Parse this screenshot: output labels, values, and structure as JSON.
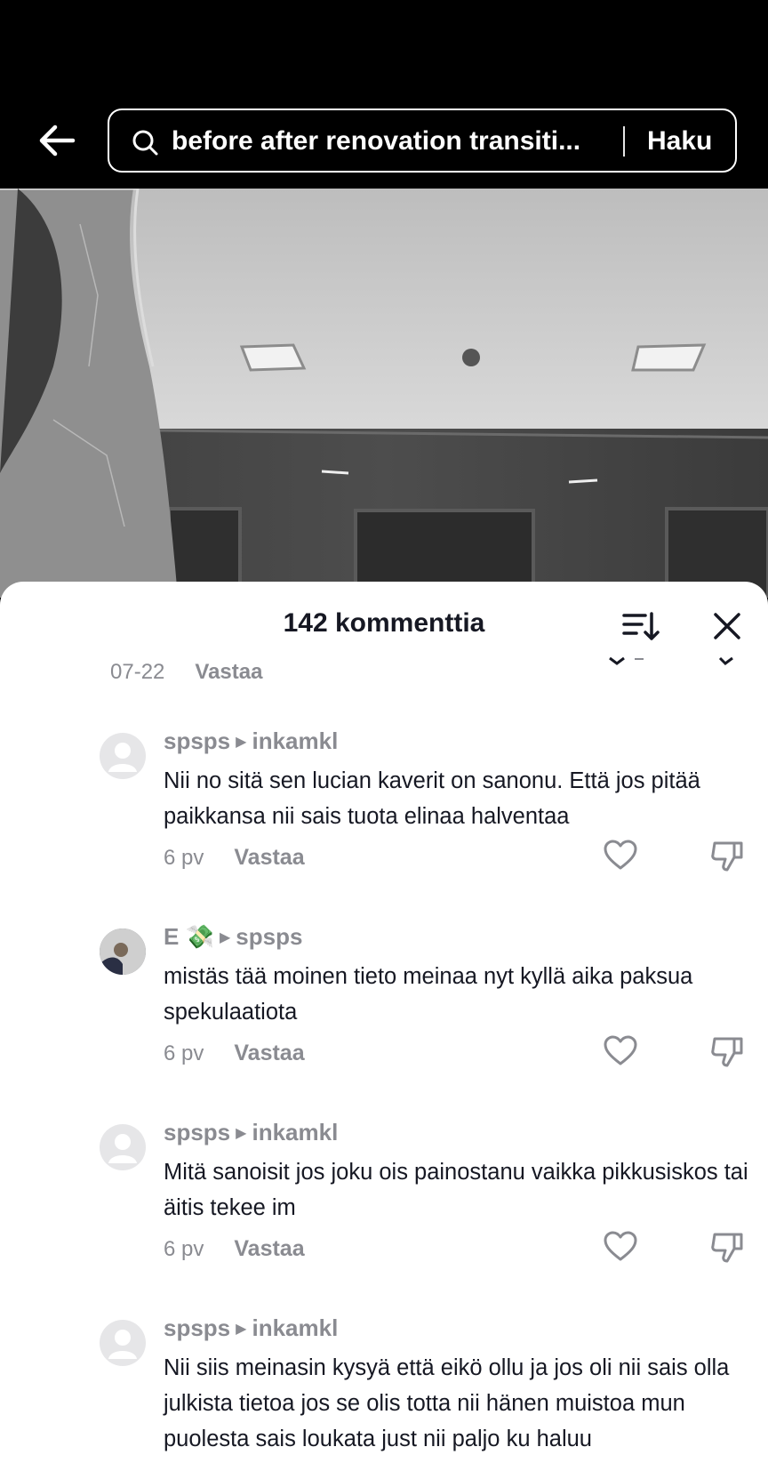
{
  "search": {
    "query": "before after renovation transiti...",
    "button_label": "Haku"
  },
  "comments_sheet": {
    "title": "142 kommenttia",
    "previous_meta": {
      "date": "07-22",
      "reply_label": "Vastaa"
    },
    "comments": [
      {
        "username": "spsps",
        "reply_to": "inkamkl",
        "text": "Nii no sitä sen lucian kaverit on sanonu. Että jos pitää paikkansa nii sais tuota elinaa halventaa",
        "time": "6 pv",
        "reply_label": "Vastaa"
      },
      {
        "username": "E 💸",
        "reply_to": "spsps",
        "text": "mistäs tää moinen tieto meinaa nyt kyllä aika paksua spekulaatiota",
        "time": "6 pv",
        "reply_label": "Vastaa"
      },
      {
        "username": "spsps",
        "reply_to": "inkamkl",
        "text": "Mitä sanoisit jos joku ois painostanu vaikka pikkusiskos tai äitis tekee im",
        "time": "6 pv",
        "reply_label": "Vastaa"
      },
      {
        "username": "spsps",
        "reply_to": "inkamkl",
        "text": "Nii siis meinasin kysyä että eikö ollu ja jos oli nii sais olla julkista tietoa jos se olis totta nii hänen muistoa mun puolesta sais loukata just nii paljo ku haluu"
      }
    ]
  },
  "icons": {
    "back": "arrow-left-icon",
    "search": "search-icon",
    "sort": "sort-icon",
    "close": "close-icon",
    "like": "heart-icon",
    "dislike": "thumbs-down-icon",
    "reply_arrow": "caret-right-icon"
  }
}
